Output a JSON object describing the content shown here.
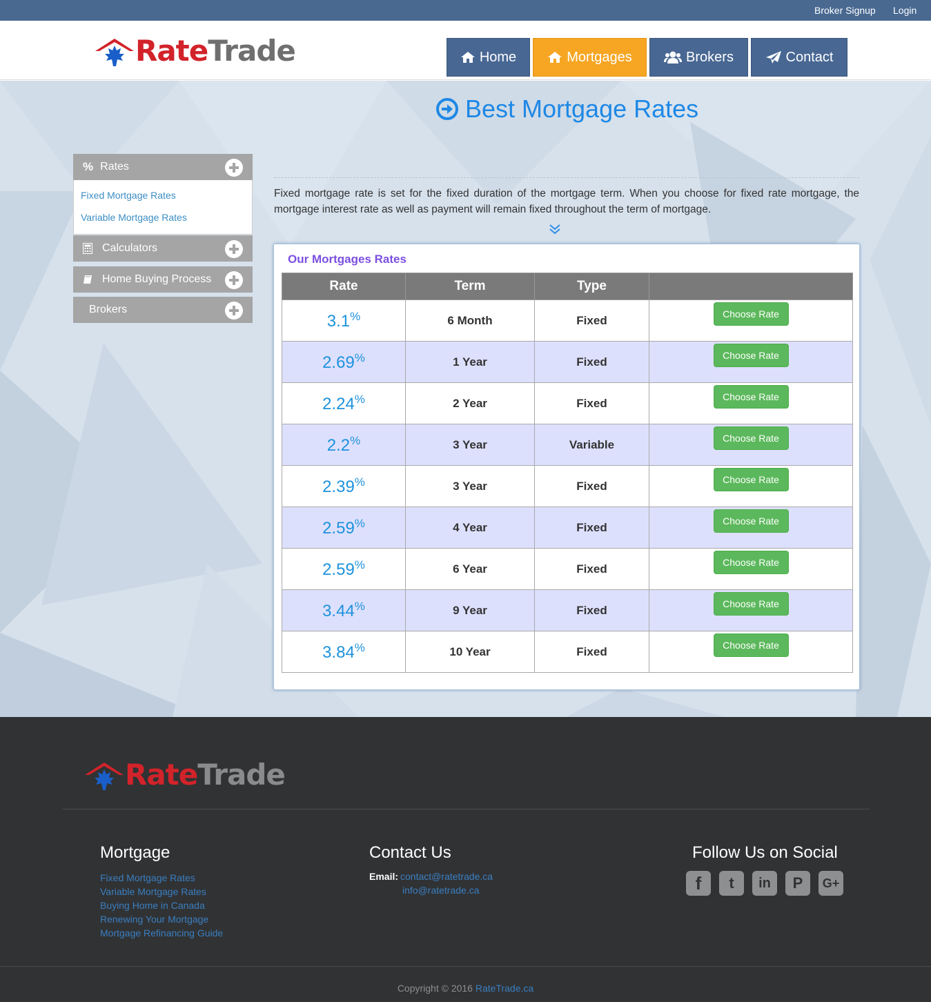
{
  "topbar": {
    "broker_signup": "Broker Signup",
    "login": "Login"
  },
  "brand": {
    "name_part1": "Rate",
    "name_part2": "Trade"
  },
  "nav": [
    {
      "label": "Home",
      "icon": "home-icon",
      "active": false
    },
    {
      "label": "Mortgages",
      "icon": "home-icon",
      "active": true
    },
    {
      "label": "Brokers",
      "icon": "users-icon",
      "active": false
    },
    {
      "label": "Contact",
      "icon": "paper-plane-icon",
      "active": false
    }
  ],
  "page": {
    "title": "Best Mortgage Rates",
    "intro": "Fixed mortgage rate is set for the fixed duration of the mortgage term. When you choose for fixed rate mortgage, the mortgage interest rate as well as payment will remain fixed throughout the term of mortgage."
  },
  "sidebar": {
    "sections": [
      {
        "label": "Rates",
        "icon": "percent-icon",
        "links": [
          "Fixed Mortgage Rates",
          "Variable Mortgage Rates"
        ]
      },
      {
        "label": "Calculators",
        "icon": "calculator-icon"
      },
      {
        "label": "Home Buying Process",
        "icon": "book-icon"
      },
      {
        "label": "Brokers",
        "icon": ""
      }
    ]
  },
  "rates_table": {
    "title": "Our Mortgages Rates",
    "headers": [
      "Rate",
      "Term",
      "Type",
      ""
    ],
    "button_label": "Choose Rate",
    "percent_sign": "%",
    "rows": [
      {
        "rate": "3.1",
        "term": "6 Month",
        "type": "Fixed"
      },
      {
        "rate": "2.69",
        "term": "1 Year",
        "type": "Fixed"
      },
      {
        "rate": "2.24",
        "term": "2 Year",
        "type": "Fixed"
      },
      {
        "rate": "2.2",
        "term": "3 Year",
        "type": "Variable"
      },
      {
        "rate": "2.39",
        "term": "3 Year",
        "type": "Fixed"
      },
      {
        "rate": "2.59",
        "term": "4 Year",
        "type": "Fixed"
      },
      {
        "rate": "2.59",
        "term": "6 Year",
        "type": "Fixed"
      },
      {
        "rate": "3.44",
        "term": "9 Year",
        "type": "Fixed"
      },
      {
        "rate": "3.84",
        "term": "10 Year",
        "type": "Fixed"
      }
    ]
  },
  "footer": {
    "mortgage_heading": "Mortgage",
    "mortgage_links": [
      "Fixed Mortgage Rates",
      "Variable Mortgage Rates",
      "Buying Home in Canada",
      "Renewing Your Mortgage",
      "Mortgage Refinancing Guide"
    ],
    "contact_heading": "Contact Us",
    "email_label": "Email:",
    "emails": [
      "contact@ratetrade.ca",
      "info@ratetrade.ca"
    ],
    "social_heading": "Follow Us on Social",
    "social": [
      {
        "name": "facebook-icon",
        "glyph": "f"
      },
      {
        "name": "twitter-icon",
        "glyph": "t"
      },
      {
        "name": "linkedin-icon",
        "glyph": "in"
      },
      {
        "name": "pinterest-icon",
        "glyph": "P"
      },
      {
        "name": "google-plus-icon",
        "glyph": "G+"
      }
    ],
    "copyright_text": "Copyright © 2016 ",
    "copyright_link": "RateTrade.ca"
  },
  "colors": {
    "topbar": "#496991",
    "nav": "#486793",
    "nav_active": "#f6a623",
    "accent_blue": "#1e88e5",
    "button_green": "#5cb85c",
    "footer": "#313234"
  }
}
